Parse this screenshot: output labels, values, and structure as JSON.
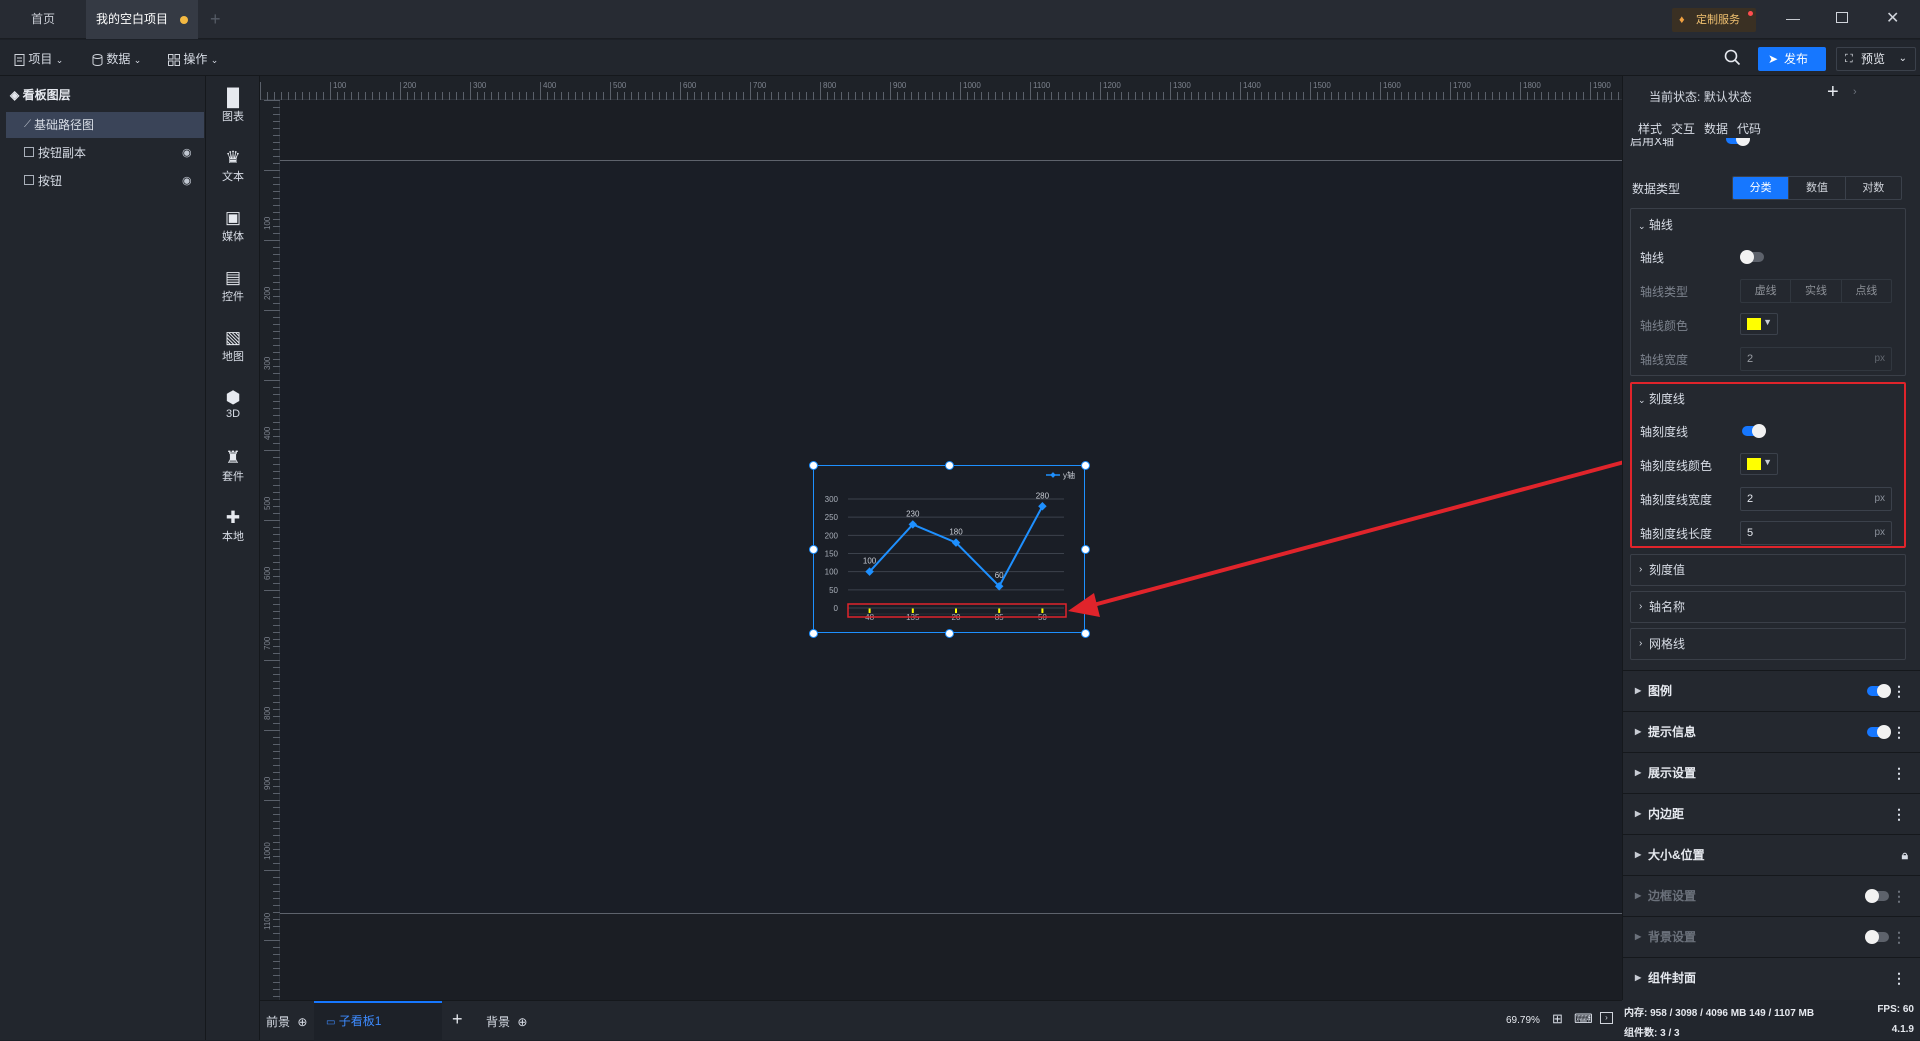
{
  "tabs": [
    {
      "label": "首页",
      "active": false
    },
    {
      "label": "我的空白项目",
      "active": true,
      "unsaved": true
    }
  ],
  "window": {
    "service_label": "定制服务"
  },
  "menubar": {
    "project": "项目",
    "data": "数据",
    "operation": "操作",
    "publish": "发布",
    "preview": "预览"
  },
  "layers": {
    "title": "看板图层",
    "items": [
      {
        "label": "基础路径图",
        "selected": true
      },
      {
        "label": "按钮副本",
        "selected": false
      },
      {
        "label": "按钮",
        "selected": false
      }
    ]
  },
  "tools": [
    "图表",
    "文本",
    "媒体",
    "控件",
    "地图",
    "3D",
    "套件",
    "本地"
  ],
  "ruler": {
    "h_ticks": [
      "100",
      "200",
      "300",
      "400",
      "500",
      "600",
      "700",
      "800",
      "900",
      "1000",
      "1100",
      "1200",
      "1300",
      "1400",
      "1500",
      "1600",
      "1700",
      "1800",
      "1900"
    ],
    "v_ticks": [
      "100",
      "200",
      "300",
      "400",
      "500",
      "600",
      "700",
      "800",
      "900",
      "1000",
      "1100"
    ]
  },
  "chart_data": {
    "type": "line",
    "categories": [
      "48",
      "135",
      "20",
      "85",
      "50"
    ],
    "series": [
      {
        "name": "y轴",
        "values": [
          100,
          230,
          180,
          60,
          280
        ]
      }
    ],
    "yticks": [
      "0",
      "50",
      "100",
      "150",
      "200",
      "250",
      "300"
    ],
    "ylim": [
      0,
      300
    ],
    "grid": true,
    "legend": "top-right",
    "color": "#1e90ff"
  },
  "bottom": {
    "foreground": "前景",
    "board_tab": "子看板1",
    "background": "背景",
    "zoom": "69.79%"
  },
  "panel": {
    "state_label": "当前状态:",
    "state_value": "默认状态",
    "tabs": [
      "样式",
      "交互",
      "数据",
      "代码"
    ],
    "partial_label": "启用X轴",
    "data_type_label": "数据类型",
    "data_type_options": [
      "分类",
      "数值",
      "对数"
    ],
    "axis_line": {
      "title": "轴线",
      "line_label": "轴线",
      "type_label": "轴线类型",
      "type_options": [
        "虚线",
        "实线",
        "点线"
      ],
      "color_label": "轴线颜色",
      "width_label": "轴线宽度",
      "width_value": "2",
      "unit": "px"
    },
    "tick_line": {
      "title": "刻度线",
      "toggle_label": "轴刻度线",
      "color_label": "轴刻度线颜色",
      "width_label": "轴刻度线宽度",
      "width_value": "2",
      "length_label": "轴刻度线长度",
      "length_value": "5",
      "unit": "px"
    },
    "collapsed": [
      "刻度值",
      "轴名称",
      "网格线"
    ],
    "sections": [
      {
        "label": "图例",
        "toggle": true,
        "dim": false
      },
      {
        "label": "提示信息",
        "toggle": true,
        "dim": false
      },
      {
        "label": "展示设置",
        "toggle": null,
        "dim": false
      },
      {
        "label": "内边距",
        "toggle": null,
        "dim": false
      },
      {
        "label": "大小&位置",
        "toggle": null,
        "dim": false
      },
      {
        "label": "边框设置",
        "toggle": false,
        "dim": true
      },
      {
        "label": "背景设置",
        "toggle": false,
        "dim": true
      },
      {
        "label": "组件封面",
        "toggle": null,
        "dim": false
      }
    ]
  },
  "status": {
    "memory": "内存: 958 / 3098 / 4096 MB  149 / 1107 MB",
    "fps": "FPS: 60",
    "components": "组件数: 3 / 3",
    "version": "4.1.9"
  },
  "colors": {
    "accent": "#1677ff",
    "highlight": "#e0242b",
    "swatch": "#ffff00"
  }
}
